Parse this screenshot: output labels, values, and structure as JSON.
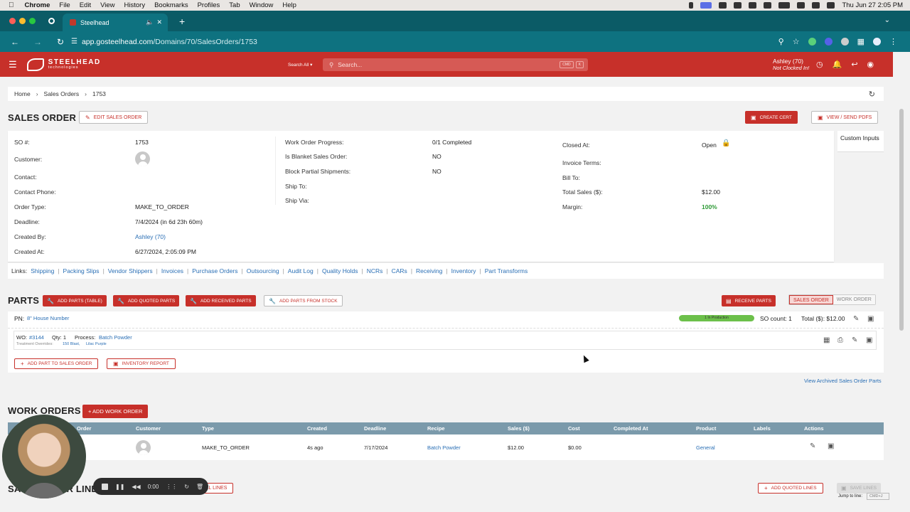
{
  "mac_menu": {
    "app": "Chrome",
    "items": [
      "File",
      "Edit",
      "View",
      "History",
      "Bookmarks",
      "Profiles",
      "Tab",
      "Window",
      "Help"
    ],
    "datetime": "Thu Jun 27  2:05 PM"
  },
  "browser": {
    "tab_title": "Steelhead",
    "url_host": "app.gosteelhead.com",
    "url_path": "/Domains/70/SalesOrders/1753"
  },
  "header": {
    "logo_text": "STEELHEAD",
    "logo_sub": "technologies",
    "search_scope": "Search All",
    "search_placeholder": "Search...",
    "kbd1": "CMD",
    "kbd2": "K",
    "user_name": "Ashley (70)",
    "user_status": "Not Clocked In!"
  },
  "breadcrumb": {
    "home": "Home",
    "sales_orders": "Sales Orders",
    "current": "1753"
  },
  "sales_order": {
    "title": "SALES ORDER",
    "edit_button": "EDIT SALES ORDER",
    "create_cert_button": "CREATE CERT",
    "view_pdfs_button": "VIEW / SEND PDFS",
    "custom_inputs_tab": "Custom Inputs",
    "col1": {
      "so_label": "SO #:",
      "so_value": "1753",
      "customer_label": "Customer:",
      "contact_label": "Contact:",
      "contact_phone_label": "Contact Phone:",
      "order_type_label": "Order Type:",
      "order_type_value": "MAKE_TO_ORDER",
      "deadline_label": "Deadline:",
      "deadline_value": "7/4/2024 (in 6d 23h 60m)",
      "created_by_label": "Created By:",
      "created_by_value": "Ashley (70)",
      "created_at_label": "Created At:",
      "created_at_value": "6/27/2024, 2:05:09 PM"
    },
    "col2": {
      "wo_progress_label": "Work Order Progress:",
      "wo_progress_value": "0/1 Completed",
      "blanket_label": "Is Blanket Sales Order:",
      "blanket_value": "NO",
      "block_partial_label": "Block Partial Shipments:",
      "block_partial_value": "NO",
      "ship_to_label": "Ship To:",
      "ship_via_label": "Ship Via:"
    },
    "col3": {
      "closed_at_label": "Closed At:",
      "closed_at_value": "Open",
      "invoice_terms_label": "Invoice Terms:",
      "bill_to_label": "Bill To:",
      "total_sales_label": "Total Sales ($):",
      "total_sales_value": "$12.00",
      "margin_label": "Margin:",
      "margin_value": "100%"
    }
  },
  "links": {
    "prefix": "Links:",
    "items": [
      "Shipping",
      "Packing Slips",
      "Vendor Shippers",
      "Invoices",
      "Purchase Orders",
      "Outsourcing",
      "Audit Log",
      "Quality Holds",
      "NCRs",
      "CARs",
      "Receiving",
      "Inventory",
      "Part Transforms"
    ]
  },
  "parts": {
    "title": "PARTS",
    "add_table": "ADD PARTS (TABLE)",
    "add_quoted": "ADD QUOTED PARTS",
    "add_received": "ADD RECEIVED PARTS",
    "add_from_stock": "ADD PARTS FROM STOCK",
    "receive_parts": "RECEIVE PARTS",
    "toggle_sales_order": "SALES ORDER",
    "toggle_work_order": "WORK ORDER",
    "pn_label": "PN:",
    "pn_value": "8\" House Number",
    "progress_label": "1 In Production",
    "so_count": "SO count:  1",
    "total": "Total ($): $12.00",
    "wo_label": "WO:",
    "wo_value": "#3144",
    "qty": "Qty:  1",
    "process_label": "Process:",
    "process_value": "Batch Powder",
    "overrides_label": "Treatment Overrides:",
    "override1": "150 Blast,",
    "override2": "Lilac Purple",
    "add_part_button": "ADD PART TO SALES ORDER",
    "inventory_report_button": "INVENTORY REPORT",
    "archived_link": "View Archived Sales Order Parts"
  },
  "work_orders": {
    "title": "WORK ORDERS",
    "add_button": "+ ADD WORK ORDER",
    "columns": [
      "Order",
      "Customer",
      "Type",
      "Created",
      "Deadline",
      "Recipe",
      "Sales ($)",
      "Cost",
      "Completed At",
      "Product",
      "Labels",
      "Actions"
    ],
    "row": {
      "type": "MAKE_TO_ORDER",
      "created": "4s ago",
      "deadline": "7/17/2024",
      "recipe": "Batch Powder",
      "sales": "$12.00",
      "cost": "$0.00",
      "product": "General"
    }
  },
  "sales_lines": {
    "title_visible": "SA",
    "title_tail": "R LINE",
    "all_lines": "ALL LINES",
    "add_quoted_lines": "ADD QUOTED LINES",
    "save_lines": "SAVE LINES",
    "jump_label": "Jump to line:",
    "jump_kbd": "CMD+J"
  },
  "recorder": {
    "time": "0:00"
  }
}
